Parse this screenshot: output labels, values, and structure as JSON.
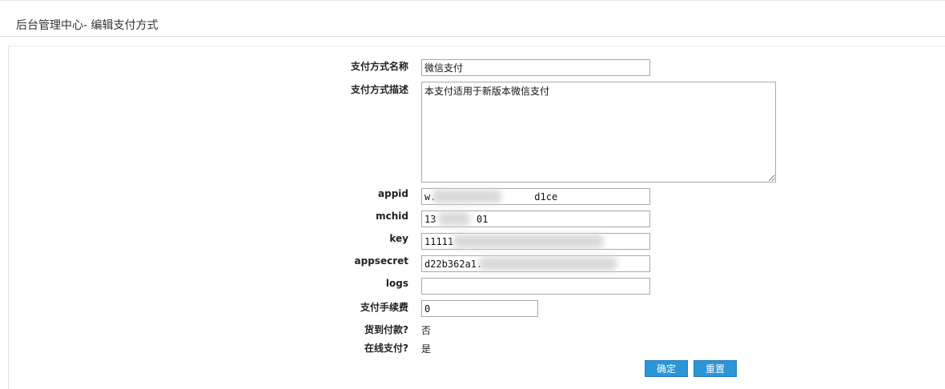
{
  "header": {
    "title": "后台管理中心- 编辑支付方式"
  },
  "form": {
    "name_label": "支付方式名称",
    "name_value": "微信支付",
    "desc_label": "支付方式描述",
    "desc_value": "本支付适用于新版本微信支付",
    "appid_label": "appid",
    "appid_value": "w.                 d1ce",
    "mchid_label": "mchid",
    "mchid_value": "13       01",
    "key_label": "key",
    "key_value": "11111",
    "appsecret_label": "appsecret",
    "appsecret_value": "d22b362a1.",
    "logs_label": "logs",
    "logs_value": "",
    "fee_label": "支付手续费",
    "fee_value": "0",
    "cod_label": "货到付款?",
    "cod_value": "否",
    "online_label": "在线支付?",
    "online_value": "是"
  },
  "buttons": {
    "confirm_label": "确定",
    "reset_label": "重置"
  }
}
